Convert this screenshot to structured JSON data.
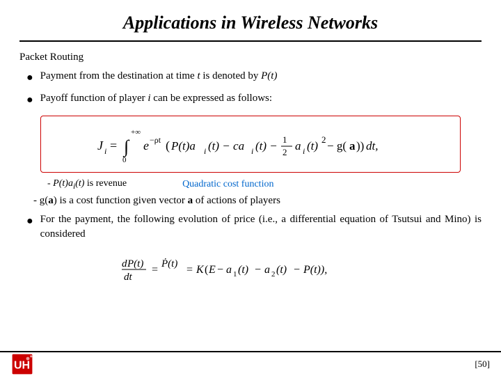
{
  "page": {
    "title": "Applications in Wireless Networks",
    "section": "Packet Routing",
    "bullets": [
      {
        "id": "bullet1",
        "text_parts": [
          "Payment from the destination at time ",
          "t",
          " is denoted by ",
          "P(t)"
        ]
      },
      {
        "id": "bullet2",
        "text_parts": [
          "Payoff function of player ",
          "i",
          " can be expressed as follows:"
        ]
      }
    ],
    "revenue_label": "- P(t)aᵢ(t) is revenue",
    "quadratic_label": "Quadratic cost function",
    "cost_function_text": "- g(a) is a cost function given vector a of actions of players",
    "bullet3_text": "For the payment, the following evolution of price (i.e., a differential equation of Tsutsui and Mino) is considered",
    "page_number": "[50]"
  }
}
